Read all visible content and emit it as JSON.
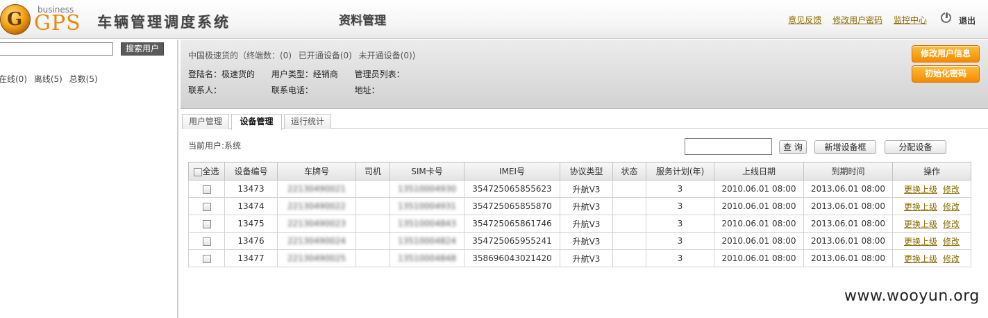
{
  "header": {
    "logo_small": "business",
    "logo_main": "GPS",
    "app_title": "车辆管理调度系统",
    "module_title": "资料管理",
    "links": [
      "意见反馈",
      "修改用户密码",
      "监控中心"
    ],
    "logout": "退出"
  },
  "left": {
    "search_value": "",
    "search_button": "搜索用户",
    "status": [
      "在线(0)",
      "离线(5)",
      "总数(5)"
    ]
  },
  "info": {
    "summary": [
      "中国极速货的（终端数：(0)",
      "已开通设备(0)",
      "未开通设备(0))"
    ],
    "login_label": "登陆名：极速货的",
    "user_type": "用户类型：经销商",
    "admin_list": "管理员列表：",
    "contact": "联系人：",
    "phone": "联系电话：",
    "address": "地址：",
    "edit_user_btn": "修改用户信息",
    "reset_pwd_btn": "初始化密码"
  },
  "tabs": [
    "用户管理",
    "设备管理",
    "运行统计"
  ],
  "toolbar": {
    "current_user": "当前用户:系统",
    "query_value": "",
    "query_btn": "查 询",
    "add_device_btn": "新增设备框",
    "assign_btn": "分配设备"
  },
  "table": {
    "headers": [
      "全选",
      "设备编号",
      "车牌号",
      "司机",
      "SIM卡号",
      "IMEI号",
      "协议类型",
      "状态",
      "服务计划(年)",
      "上线日期",
      "到期时间",
      "操作"
    ],
    "rows": [
      {
        "id": "13473",
        "plate": "22130490021",
        "driver": "",
        "sim": "13510004930",
        "imei": "354725065855623",
        "protocol": "升航V3",
        "state": "",
        "plan": "3",
        "online": "2010.06.01 08:00",
        "expire": "2013.06.01 08:00",
        "op1": "更换上级",
        "op2": "修改"
      },
      {
        "id": "13474",
        "plate": "22130490022",
        "driver": "",
        "sim": "13510004931",
        "imei": "354725065855870",
        "protocol": "升航V3",
        "state": "",
        "plan": "3",
        "online": "2010.06.01 08:00",
        "expire": "2013.06.01 08:00",
        "op1": "更换上级",
        "op2": "修改"
      },
      {
        "id": "13475",
        "plate": "22130490023",
        "driver": "",
        "sim": "13510004843",
        "imei": "354725065861746",
        "protocol": "升航V3",
        "state": "",
        "plan": "3",
        "online": "2010.06.01 08:00",
        "expire": "2013.06.01 08:00",
        "op1": "更换上级",
        "op2": "修改"
      },
      {
        "id": "13476",
        "plate": "22130490024",
        "driver": "",
        "sim": "13510004824",
        "imei": "354725065955241",
        "protocol": "升航V3",
        "state": "",
        "plan": "3",
        "online": "2010.06.01 08:00",
        "expire": "2013.06.01 08:00",
        "op1": "更换上级",
        "op2": "修改"
      },
      {
        "id": "13477",
        "plate": "22130490025",
        "driver": "",
        "sim": "13510004848",
        "imei": "358696043021420",
        "protocol": "升航V3",
        "state": "",
        "plan": "3",
        "online": "2010.06.01 08:00",
        "expire": "2013.06.01 08:00",
        "op1": "更换上级",
        "op2": "修改"
      }
    ]
  },
  "watermark": "www.wooyun.org",
  "colors": {
    "accent_orange": "#f28b00",
    "link_gold": "#8a6a00",
    "logo_orange": "#e88a08"
  }
}
